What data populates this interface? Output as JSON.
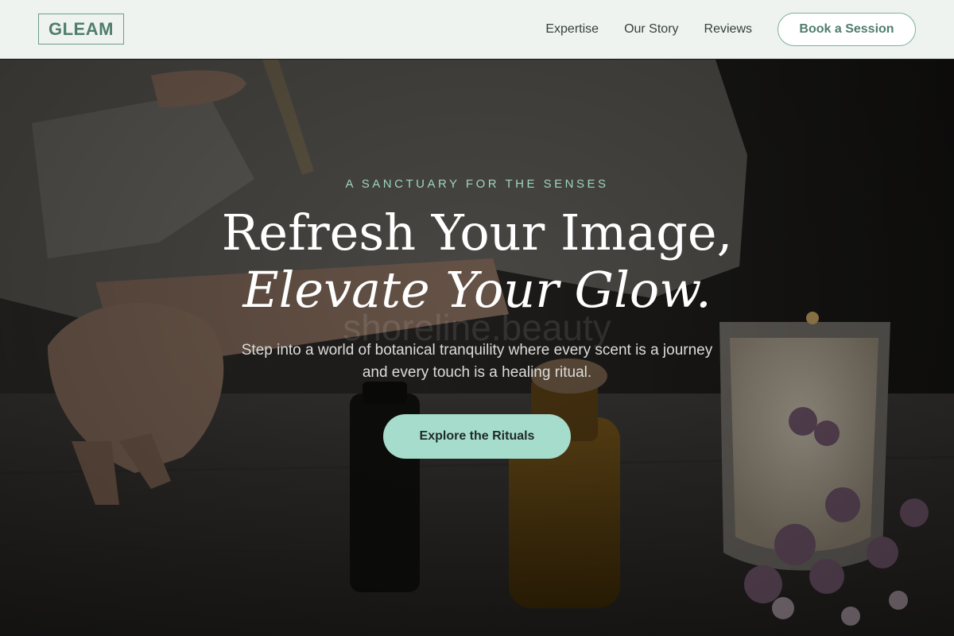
{
  "header": {
    "logo": "GLEAM",
    "nav": [
      {
        "label": "Expertise"
      },
      {
        "label": "Our Story"
      },
      {
        "label": "Reviews"
      }
    ],
    "cta_label": "Book a Session"
  },
  "hero": {
    "eyebrow": "A SANCTUARY FOR THE SENSES",
    "headline_line1": "Refresh Your Image,",
    "headline_line2": "Elevate Your Glow.",
    "watermark": "shoreline.beauty",
    "subtext": "Step into a world of botanical tranquility where every scent is a journey and every touch is a healing ritual.",
    "cta_label": "Explore the Rituals"
  },
  "colors": {
    "accent": "#a6dccb",
    "brand": "#4f7d6e",
    "header_bg": "#eef3ef"
  }
}
